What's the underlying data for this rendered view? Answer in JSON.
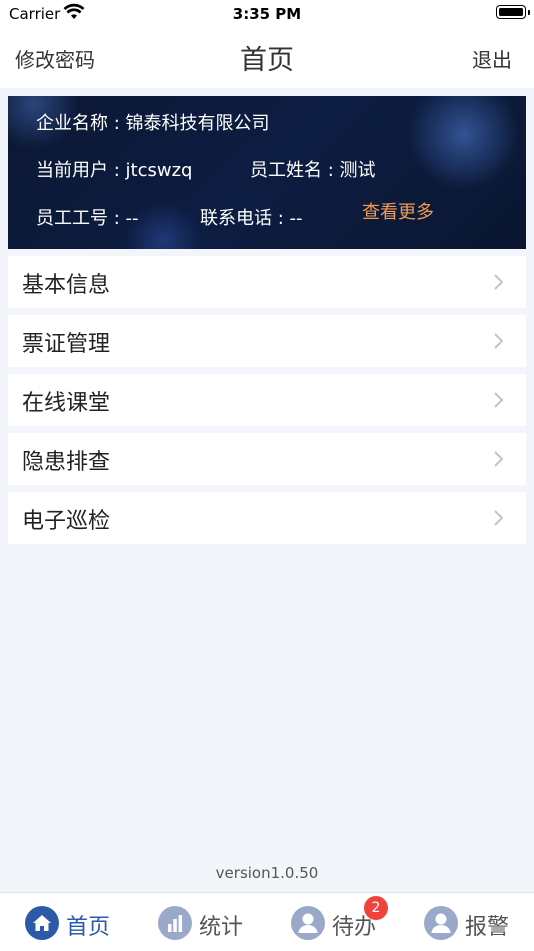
{
  "status_bar": {
    "carrier": "Carrier",
    "time": "3:35 PM"
  },
  "nav": {
    "left": "修改密码",
    "title": "首页",
    "right": "退出"
  },
  "info": {
    "company_label": "企业名称",
    "company": "锦泰科技有限公司",
    "user_label": "当前用户",
    "user": "jtcswzq",
    "name_label": "员工姓名",
    "name": "测试",
    "id_label": "员工工号",
    "id": "--",
    "phone_label": "联系电话",
    "phone": "--",
    "more": "查看更多"
  },
  "menu": [
    {
      "label": "基本信息"
    },
    {
      "label": "票证管理"
    },
    {
      "label": "在线课堂"
    },
    {
      "label": "隐患排查"
    },
    {
      "label": "电子巡检"
    }
  ],
  "version": "version1.0.50",
  "tabs": [
    {
      "label": "首页",
      "icon": "home-icon",
      "active": true
    },
    {
      "label": "统计",
      "icon": "chart-icon"
    },
    {
      "label": "待办",
      "icon": "person-icon",
      "badge": "2"
    },
    {
      "label": "报警",
      "icon": "person-icon"
    }
  ],
  "colors": {
    "accent": "#2c5aa8",
    "link_orange": "#f39a54",
    "badge_red": "#f0433b",
    "panel_bg": "#0d1d42"
  }
}
